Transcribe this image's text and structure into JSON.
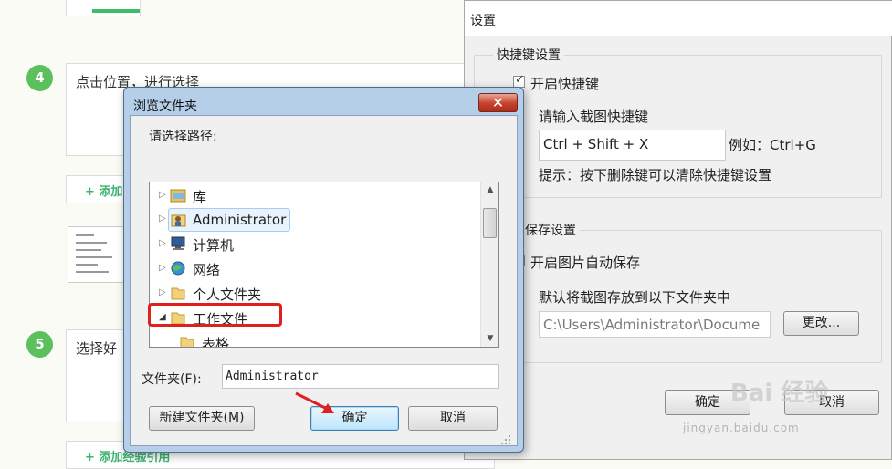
{
  "background": {
    "step4": {
      "number": "4",
      "text": "点击位置，进行选择"
    },
    "step5": {
      "number": "5",
      "text": "选择好"
    },
    "add_btn": "+ 添加",
    "add_ref_btn": "+ 添加经验引用"
  },
  "settings": {
    "title": "设置",
    "hotkey_group": "快捷键设置",
    "enable_hotkey": "开启快捷键",
    "enable_hotkey_checked": true,
    "prompt": "请输入截图快捷键",
    "hotkey_value": "Ctrl + Shift + X",
    "example": "例如：Ctrl+G",
    "hint": "提示：按下删除键可以清除快捷键设置",
    "save_group": "保存设置",
    "auto_save": "开启图片自动保存",
    "default_folder_label": "默认将截图存放到以下文件夹中",
    "folder_path": "C:\\Users\\Administrator\\Docume",
    "change_btn": "更改...",
    "ok_btn": "确定",
    "cancel_btn": "取消"
  },
  "dialog": {
    "title": "浏览文件夹",
    "close": "✕",
    "prompt": "请选择路径:",
    "tree": [
      {
        "label": "库",
        "icon": "library-icon",
        "expanded": false
      },
      {
        "label": "Administrator",
        "icon": "user-folder-icon",
        "expanded": false,
        "selected": true
      },
      {
        "label": "计算机",
        "icon": "computer-icon",
        "expanded": false
      },
      {
        "label": "网络",
        "icon": "network-icon",
        "expanded": false
      },
      {
        "label": "个人文件夹",
        "icon": "folder-icon",
        "expanded": false
      },
      {
        "label": "工作文件",
        "icon": "folder-icon",
        "expanded": true
      },
      {
        "label": "表格",
        "icon": "folder-icon",
        "child": true
      }
    ],
    "folder_label": "文件夹(F):",
    "folder_value": "Administrator",
    "new_folder_btn": "新建文件夹(M)",
    "ok_btn": "确定",
    "cancel_btn": "取消"
  },
  "watermark": {
    "text": "Bai 经验",
    "url": "jingyan.baidu.com"
  },
  "colors": {
    "step_green": "#5cc05c",
    "highlight_red": "#e0201c",
    "dialog_frame": "#b6cfe8"
  }
}
